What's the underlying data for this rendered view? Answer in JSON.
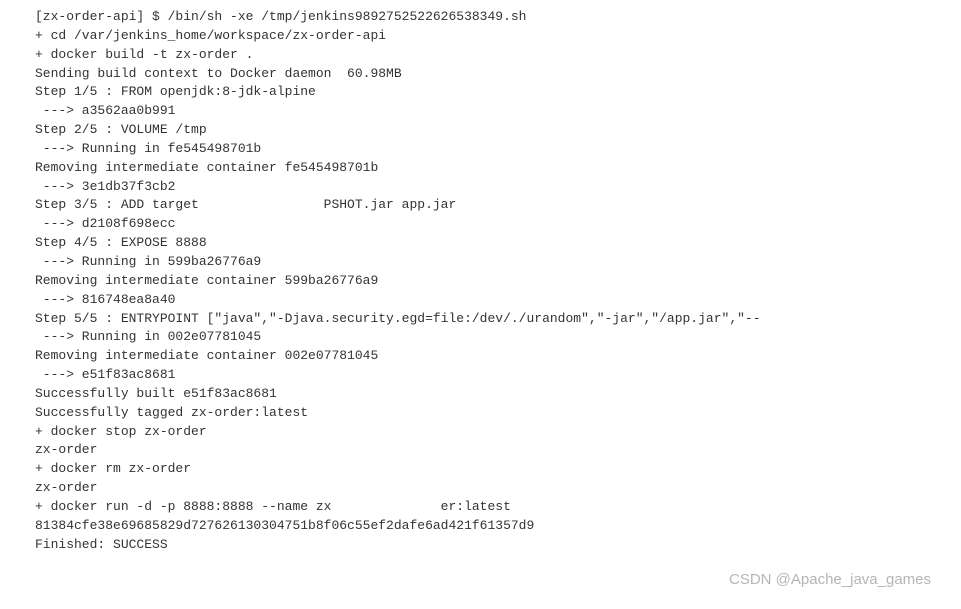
{
  "console": {
    "lines": [
      "[zx-order-api] $ /bin/sh -xe /tmp/jenkins9892752522626538349.sh",
      "+ cd /var/jenkins_home/workspace/zx-order-api",
      "+ docker build -t zx-order .",
      "Sending build context to Docker daemon  60.98MB",
      "",
      "Step 1/5 : FROM openjdk:8-jdk-alpine",
      " ---> a3562aa0b991",
      "Step 2/5 : VOLUME /tmp",
      " ---> Running in fe545498701b",
      "Removing intermediate container fe545498701b",
      " ---> 3e1db37f3cb2",
      "Step 3/5 : ADD target                PSHOT.jar app.jar",
      " ---> d2108f698ecc",
      "Step 4/5 : EXPOSE 8888",
      " ---> Running in 599ba26776a9",
      "Removing intermediate container 599ba26776a9",
      " ---> 816748ea8a40",
      "Step 5/5 : ENTRYPOINT [\"java\",\"-Djava.security.egd=file:/dev/./urandom\",\"-jar\",\"/app.jar\",\"--                                \"",
      " ---> Running in 002e07781045",
      "Removing intermediate container 002e07781045",
      " ---> e51f83ac8681",
      "Successfully built e51f83ac8681",
      "Successfully tagged zx-order:latest",
      "+ docker stop zx-order",
      "zx-order",
      "+ docker rm zx-order",
      "zx-order",
      "+ docker run -d -p 8888:8888 --name zx              er:latest",
      "81384cfe38e69685829d727626130304751b8f06c55ef2dafe6ad421f61357d9",
      "Finished: SUCCESS"
    ]
  },
  "watermark": "CSDN @Apache_java_games"
}
